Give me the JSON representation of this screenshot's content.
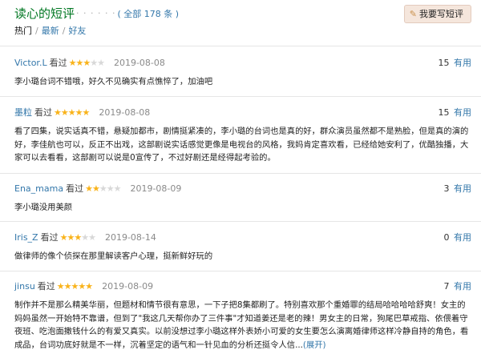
{
  "header": {
    "title": "读心的短评",
    "dots": "· · · · · ·",
    "total": "( 全部 178 条 )",
    "write_button": "我要写短评"
  },
  "tabs": {
    "hot": "热门",
    "sep1": "/",
    "latest": "最新",
    "sep2": "/",
    "friends": "好友"
  },
  "reviews": [
    {
      "user": "Victor.L",
      "watched": "看过",
      "rating": 3,
      "date": "2019-08-08",
      "useful_count": "15",
      "useful_label": "有用",
      "text": "李小璐台词不错哦，好久不见确实有点憔悴了，加油吧"
    },
    {
      "user": "墨粒",
      "watched": "看过",
      "rating": 5,
      "date": "2019-08-08",
      "useful_count": "15",
      "useful_label": "有用",
      "text": "看了四集，说实话真不错，悬疑加都市，剧情挺紧凑的，李小璐的台词也是真的好，群众演员虽然都不是熟脸，但是真的演的好，李佳航也可以，反正不出戏，这部剧说实话感觉更像是电视台的风格，我妈肯定喜欢看，已经给她安利了，优酷独播，大家可以去看看，这部剧可以说是0宣传了，不过好剧还是经得起考验的。"
    },
    {
      "user": "Ena_mama",
      "watched": "看过",
      "rating": 2,
      "date": "2019-08-09",
      "useful_count": "3",
      "useful_label": "有用",
      "text": "李小璐没用美颜"
    },
    {
      "user": "Iris_Z",
      "watched": "看过",
      "rating": 3,
      "date": "2019-08-14",
      "useful_count": "0",
      "useful_label": "有用",
      "text": "做律师的像个侦探在那里解读客户心理，挺新鲜好玩的"
    },
    {
      "user": "jinsu",
      "watched": "看过",
      "rating": 5,
      "date": "2019-08-09",
      "useful_count": "7",
      "useful_label": "有用",
      "text": "制作并不是那么精美华丽，但题材和情节很有意思，一下子把8集都刷了。特别喜欢那个重婚罪的结局哈哈哈哈舒爽！女主的妈妈虽然一开始特不靠谱，但到了\"我这几天帮你办了三件事\"才知道姜还是老的辣！男女主的日常，狗尾巴草戒指、依偎着守夜班、吃泡面撒钱什么的有爱又真实。以前没想过李小璐这样外表娇小可爱的女生要怎么演离婚律师这样冷静自持的角色，看成品，台词功底好就是不一样，沉着坚定的语气和一针见血的分析还挺令人信...",
      "expand": "(展开)"
    }
  ]
}
